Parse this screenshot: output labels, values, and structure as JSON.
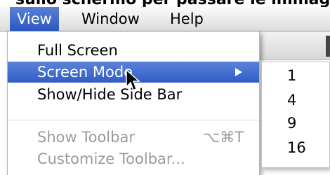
{
  "background_text": "sullo schermo per passare le immagini",
  "menubar": {
    "items": [
      {
        "label": "View"
      },
      {
        "label": "Window"
      },
      {
        "label": "Help"
      }
    ]
  },
  "view_menu": {
    "items": [
      {
        "label": "Full Screen",
        "state": "enabled"
      },
      {
        "label": "Screen Mode",
        "state": "highlighted",
        "has_submenu": true
      },
      {
        "label": "Show/Hide Side Bar",
        "state": "enabled"
      },
      {
        "label": "Show Toolbar",
        "state": "disabled",
        "shortcut": "⌥⌘T"
      },
      {
        "label": "Customize Toolbar...",
        "state": "disabled"
      }
    ]
  },
  "screen_mode_submenu": {
    "items": [
      {
        "label": "1"
      },
      {
        "label": "4"
      },
      {
        "label": "9"
      },
      {
        "label": "16"
      }
    ]
  },
  "colors": {
    "highlight": "#2f5cc6",
    "disabled_text": "#9a9a9a"
  },
  "icons": {
    "submenu_arrow": "triangle-right-icon",
    "cursor": "mouse-pointer-icon"
  }
}
